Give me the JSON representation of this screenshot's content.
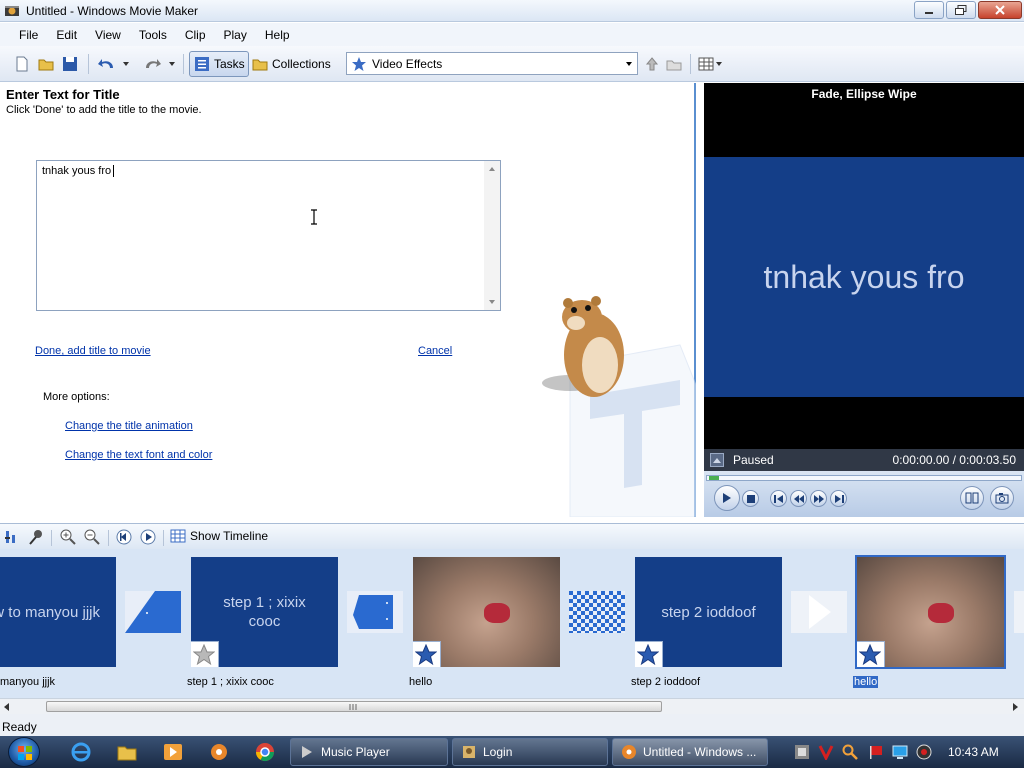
{
  "window": {
    "title": "Untitled - Windows Movie Maker"
  },
  "menu": [
    "File",
    "Edit",
    "View",
    "Tools",
    "Clip",
    "Play",
    "Help"
  ],
  "toolbar": {
    "tasks_label": "Tasks",
    "collections_label": "Collections",
    "collection_select": "Video Effects"
  },
  "task_pane": {
    "heading": "Enter Text for Title",
    "instruction": "Click 'Done' to add the title to the movie.",
    "title_text": "tnhak yous fro",
    "done_link": "Done, add title to movie",
    "cancel_link": "Cancel",
    "more_options": "More options:",
    "option_animation": "Change the title animation",
    "option_font": "Change the text font and color"
  },
  "preview": {
    "header": "Fade, Ellipse Wipe",
    "screen_text": "tnhak yous fro",
    "status": "Paused",
    "time": "0:00:00.00 / 0:00:03.50",
    "progress": 0.0
  },
  "storyboard": {
    "show_timeline_label": "Show Timeline",
    "clips": [
      {
        "name": "manyou jjjk",
        "kind": "title",
        "text": "ow to manyou jjjk",
        "selected": false
      },
      {
        "name": "step 1 ; xixix cooc",
        "kind": "title",
        "text": "step 1 ; xixix cooc",
        "selected": false
      },
      {
        "name": "hello",
        "kind": "video",
        "text": "",
        "selected": false
      },
      {
        "name": "step 2 ioddoof",
        "kind": "title",
        "text": "step 2 ioddoof",
        "selected": false
      },
      {
        "name": "hello",
        "kind": "video",
        "text": "",
        "selected": true
      }
    ]
  },
  "statusbar": {
    "text": "Ready"
  },
  "taskbar": {
    "tasks": [
      "Music Player",
      "Login",
      "Untitled - Windows ..."
    ],
    "clock": "10:43 AM"
  },
  "colors": {
    "accent": "#143e88",
    "selection": "#3169c6",
    "link": "#0033aa"
  }
}
